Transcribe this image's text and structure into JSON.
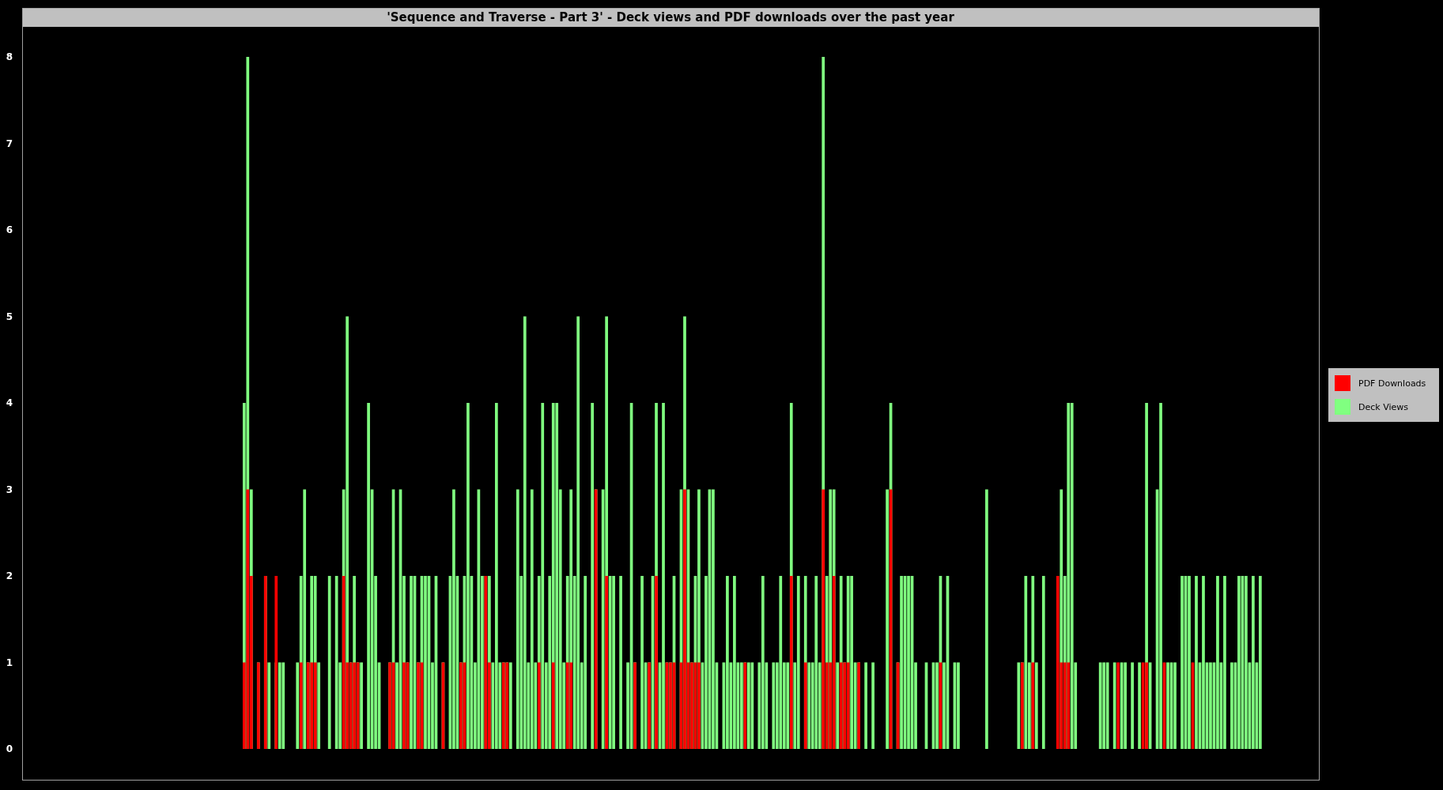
{
  "chart": {
    "title": "'Sequence and Traverse - Part 3' - Deck views and PDF downloads over the past year",
    "y_axis_labels": [
      "8",
      "7",
      "6",
      "5",
      "4",
      "3",
      "2",
      "1",
      "0"
    ],
    "legend": [
      {
        "label": "PDF Downloads",
        "color": "#ff0000"
      },
      {
        "label": "Deck Views",
        "color": "#80ff80"
      }
    ]
  }
}
